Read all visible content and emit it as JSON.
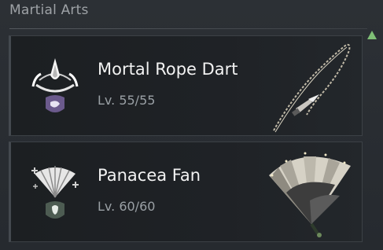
{
  "section": {
    "title": "Martial Arts"
  },
  "weapons": [
    {
      "name": "Mortal Rope Dart",
      "level": "Lv. 55/55",
      "emblem_icon": "rope-dart-school-emblem-icon",
      "weapon_icon": "rope-dart-weapon-icon"
    },
    {
      "name": "Panacea Fan",
      "level": "Lv. 60/60",
      "emblem_icon": "fan-school-emblem-icon",
      "weapon_icon": "fan-weapon-icon"
    }
  ],
  "colors": {
    "accent_green": "#7fbf76",
    "card_bg": "#1f2226",
    "emblem_purple": "#6b5a8c",
    "emblem_green": "#4d5c52"
  }
}
